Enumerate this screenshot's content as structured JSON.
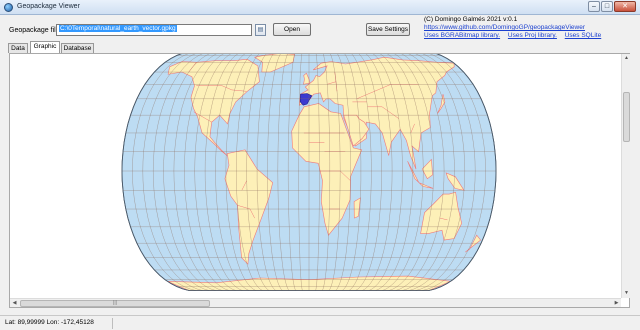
{
  "window": {
    "title": "Geopackage Viewer",
    "buttons": {
      "minimize": "–",
      "maximize": "□",
      "close": "✕"
    }
  },
  "toolbar": {
    "file_label": "Geopackage file",
    "file_value": "C:\\0Temporal\\natural_earth_vector.gpkg",
    "browse_icon": "folder-open-icon",
    "open_label": "Open",
    "save_settings_label": "Save Settings"
  },
  "about": {
    "copyright": "(C) Domingo Galmés 2021 v:0.1",
    "repo_link": "https://www.github.com/DomingoGP/geopackageViewer",
    "uses": [
      "Uses BGRABitmap library.",
      "Uses Proj library.",
      "Uses SQLite"
    ]
  },
  "tabs": [
    "Data",
    "Graphic",
    "Database"
  ],
  "active_tab": "Graphic",
  "map": {
    "projection": "Robinson",
    "ocean_color": "#bddcf3",
    "land_color": "#fdf0b8",
    "border_color": "#f07a7a",
    "graticule_color": "#8a6a5a",
    "highlight_color": "#3a3ad0",
    "graticule_step_degrees": 10,
    "highlighted_feature": "Spain"
  },
  "scrollbars": {
    "up_arrow": "▲",
    "down_arrow": "▼",
    "left_arrow": "◀",
    "right_arrow": "▶",
    "grip": "|||"
  },
  "statusbar": {
    "coordinates": "Lat: 89,99999 Lon: -172,45128"
  }
}
